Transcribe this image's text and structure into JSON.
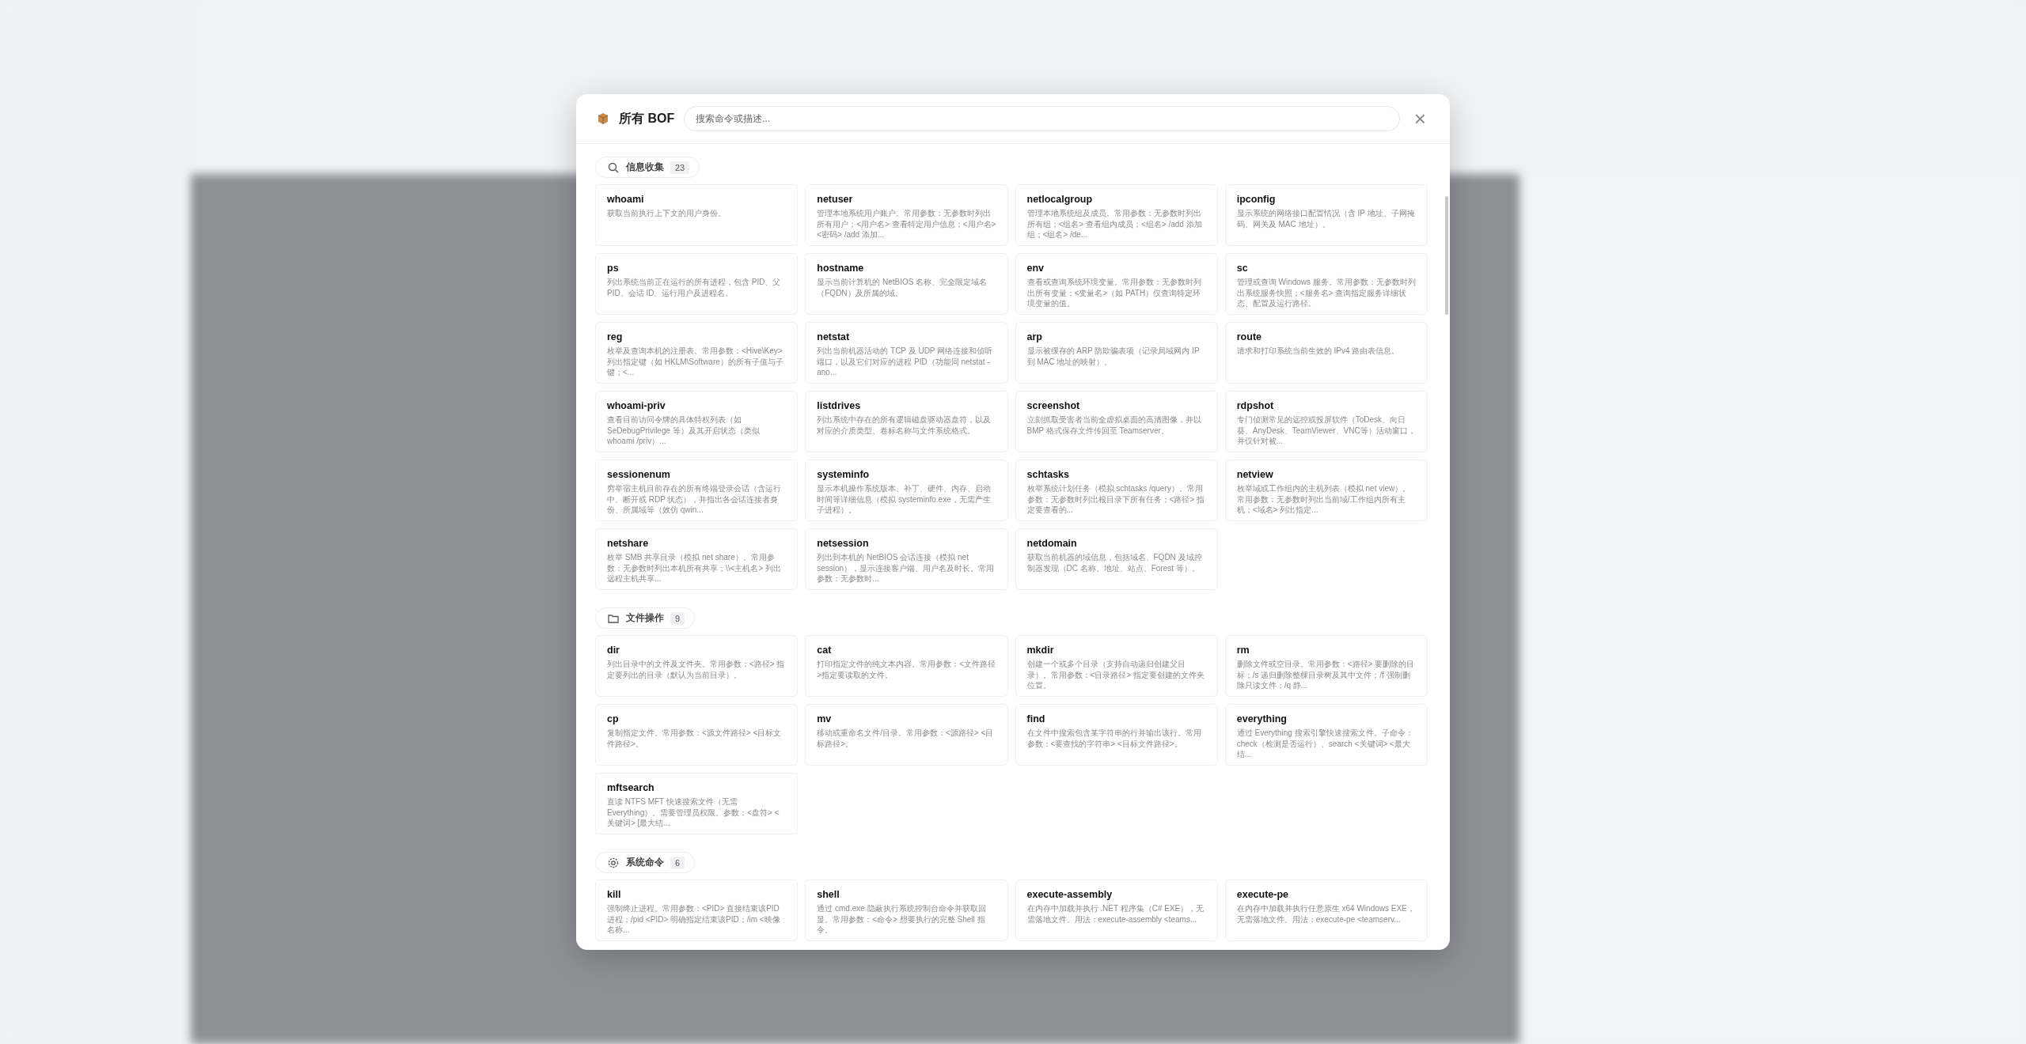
{
  "dialog": {
    "title": "所有 BOF",
    "search": {
      "placeholder": "搜索命令或描述..."
    },
    "close": "×"
  },
  "sections": [
    {
      "kind": "search",
      "label": "信息收集",
      "count": "23",
      "items": [
        {
          "name": "whoami",
          "desc": "获取当前执行上下文的用户身份。"
        },
        {
          "name": "netuser",
          "desc": "管理本地系统用户账户。常用参数：无参数时列出所有用户；<用户名> 查看特定用户信息；<用户名> <密码> /add 添加..."
        },
        {
          "name": "netlocalgroup",
          "desc": "管理本地系统组及成员。常用参数：无参数时列出所有组；<组名> 查看组内成员；<组名> /add 添加组；<组名> /de..."
        },
        {
          "name": "ipconfig",
          "desc": "显示系统的网络接口配置情况（含 IP 地址、子网掩码、网关及 MAC 地址）。"
        },
        {
          "name": "ps",
          "desc": "列出系统当前正在运行的所有进程，包含 PID、父 PID、会话 ID、运行用户及进程名。"
        },
        {
          "name": "hostname",
          "desc": "显示当前计算机的 NetBIOS 名称、完全限定域名（FQDN）及所属的域。"
        },
        {
          "name": "env",
          "desc": "查看或查询系统环境变量。常用参数：无参数时列出所有变量；<变量名>（如 PATH）仅查询特定环境变量的值。"
        },
        {
          "name": "sc",
          "desc": "管理或查询 Windows 服务。常用参数：无参数时列出系统服务快照；<服务名> 查询指定服务详细状态、配置及运行路径。"
        },
        {
          "name": "reg",
          "desc": "枚举及查询本机的注册表。常用参数：<Hive\\Key> 列出指定键（如 HKLM\\Software）的所有子值与子键；<..."
        },
        {
          "name": "netstat",
          "desc": "列出当前机器活动的 TCP 及 UDP 网络连接和侦听端口，以及它们对应的进程 PID（功能同 netstat -ano..."
        },
        {
          "name": "arp",
          "desc": "显示被缓存的 ARP 防欺骗表项（记录局域网内 IP 到 MAC 地址的映射）。"
        },
        {
          "name": "route",
          "desc": "请求和打印系统当前生效的 IPv4 路由表信息。"
        },
        {
          "name": "whoami-priv",
          "desc": "查看目前访问令牌的具体特权列表（如 SeDebugPrivilege 等）及其开启状态（类似 whoami /priv）..."
        },
        {
          "name": "listdrives",
          "desc": "列出系统中存在的所有逻辑磁盘驱动器盘符，以及对应的介质类型、卷标名称与文件系统格式。"
        },
        {
          "name": "screenshot",
          "desc": "立刻抓取受害者当前全虚拟桌面的高清图像，并以 BMP 格式保存文件传回至 Teamserver。"
        },
        {
          "name": "rdpshot",
          "desc": "专门侦测常见的远控或投屏软件（ToDesk、向日葵、AnyDesk、TeamViewer、VNC等）活动窗口，并仅针对被..."
        },
        {
          "name": "sessionenum",
          "desc": "穷举宿主机目前存在的所有终端登录会话（含运行中、断开或 RDP 状态），并指出各会话连接者身份、所属域等（效仿 qwin..."
        },
        {
          "name": "systeminfo",
          "desc": "显示本机操作系统版本、补丁、硬件、内存、启动时间等详细信息（模拟 systeminfo.exe，无需产生子进程）。"
        },
        {
          "name": "schtasks",
          "desc": "枚举系统计划任务（模拟 schtasks /query）。常用参数：无参数时列出根目录下所有任务；<路径> 指定要查看的..."
        },
        {
          "name": "netview",
          "desc": "枚举域或工作组内的主机列表（模拟 net view）。常用参数：无参数时列出当前域/工作组内所有主机；<域名> 列出指定..."
        },
        {
          "name": "netshare",
          "desc": "枚举 SMB 共享目录（模拟 net share）。常用参数：无参数时列出本机所有共享；\\\\<主机名> 列出远程主机共享..."
        },
        {
          "name": "netsession",
          "desc": "列出到本机的 NetBIOS 会话连接（模拟 net session），显示连接客户端、用户名及时长。常用参数：无参数时..."
        },
        {
          "name": "netdomain",
          "desc": "获取当前机器的域信息，包括域名、FQDN 及域控制器发现（DC 名称、地址、站点、Forest 等）。"
        }
      ]
    },
    {
      "kind": "folder",
      "label": "文件操作",
      "count": "9",
      "items": [
        {
          "name": "dir",
          "desc": "列出目录中的文件及文件夹。常用参数：<路径> 指定要列出的目录（默认为当前目录）。"
        },
        {
          "name": "cat",
          "desc": "打印指定文件的纯文本内容。常用参数：<文件路径>指定要读取的文件。"
        },
        {
          "name": "mkdir",
          "desc": "创建一个或多个目录（支持自动递归创建父目录）。常用参数：<目录路径> 指定要创建的文件夹位置。"
        },
        {
          "name": "rm",
          "desc": "删除文件或空目录。常用参数：<路径> 要删除的目标；/s 递归删除整棵目录树及其中文件；/f 强制删除只读文件；/q 静..."
        },
        {
          "name": "cp",
          "desc": "复制指定文件。常用参数：<源文件路径> <目标文件路径>。"
        },
        {
          "name": "mv",
          "desc": "移动或重命名文件/目录。常用参数：<源路径> <目标路径>。"
        },
        {
          "name": "find",
          "desc": "在文件中搜索包含某字符串的行并输出该行。常用参数：<要查找的字符串> <目标文件路径>。"
        },
        {
          "name": "everything",
          "desc": "通过 Everything 搜索引擎快速搜索文件。子命令：check（检测是否运行）、search <关键词> <最大结..."
        },
        {
          "name": "mftsearch",
          "desc": "直读 NTFS MFT 快速搜索文件（无需 Everything）。需要管理员权限。参数：<盘符> <关键词> [最大结..."
        }
      ]
    },
    {
      "kind": "gear",
      "label": "系统命令",
      "count": "6",
      "items": [
        {
          "name": "kill",
          "desc": "强制终止进程。常用参数：<PID> 直接结束该PID进程；/pid <PID> 明确指定结束该PID；/im <映像名称..."
        },
        {
          "name": "shell",
          "desc": "通过 cmd.exe 隐蔽执行系统控制台命令并获取回显。常用参数：<命令> 想要执行的完整 Shell 指令。"
        },
        {
          "name": "execute-assembly",
          "desc": "在内存中加载并执行 .NET 程序集（C# EXE），无需落地文件。用法：execute-assembly <teams..."
        },
        {
          "name": "execute-pe",
          "desc": "在内存中加载并执行任意原生 x64 Windows EXE，无需落地文件。用法：execute-pe <teamserv..."
        }
      ]
    }
  ]
}
